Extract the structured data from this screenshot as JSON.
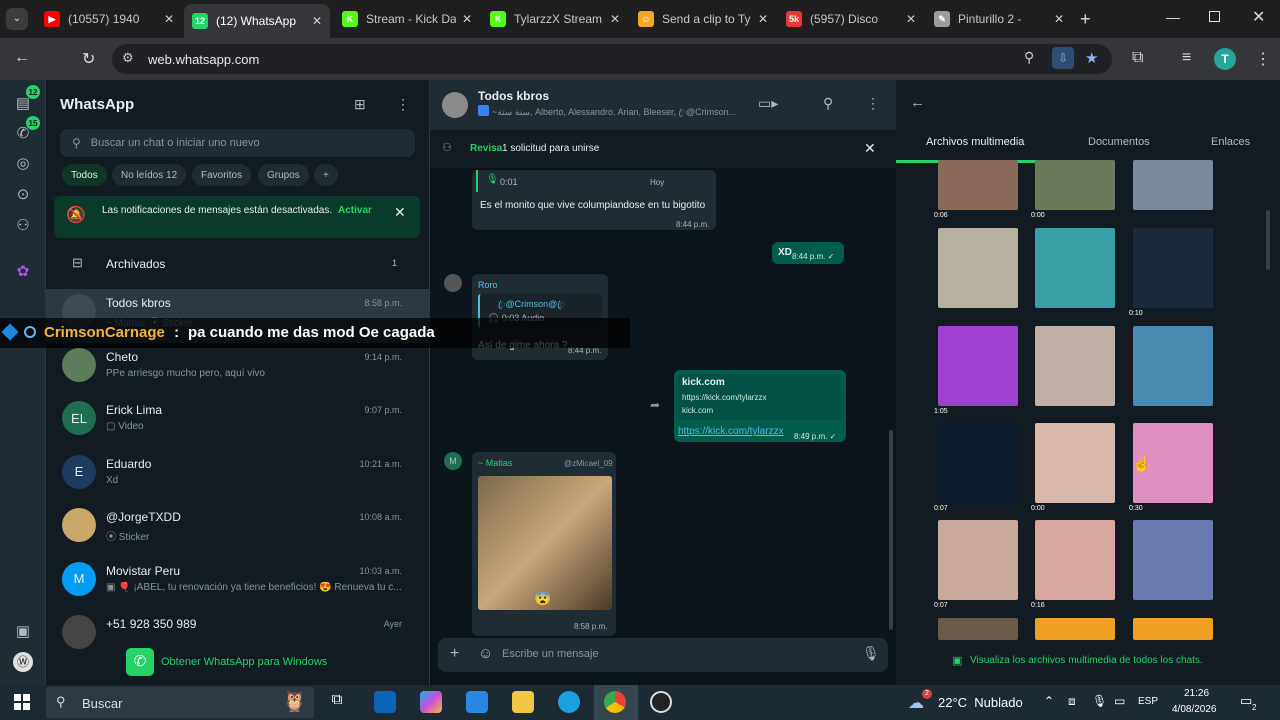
{
  "browser": {
    "tabs": [
      {
        "title": "(10557) 1940",
        "color": "#ff0000",
        "icon": "youtube-icon",
        "glyph": "▶"
      },
      {
        "title": "(12) WhatsApp",
        "color": "#25d366",
        "icon": "whatsapp-icon",
        "glyph": "12"
      },
      {
        "title": "Stream - Kick Da",
        "color": "#53fc18",
        "icon": "kick-icon",
        "glyph": "K"
      },
      {
        "title": "TylarzzX Stream",
        "color": "#53fc18",
        "icon": "kick-icon",
        "glyph": "K"
      },
      {
        "title": "Send a clip to Ty",
        "color": "#f5a623",
        "icon": "clip-icon",
        "glyph": "☺"
      },
      {
        "title": "(5957) Disco",
        "color": "#e53935",
        "icon": "discord-icon",
        "glyph": "5k"
      },
      {
        "title": "Pinturillo 2 -",
        "color": "#9e9e9e",
        "icon": "brush-icon",
        "glyph": "✎"
      }
    ],
    "url": "web.whatsapp.com",
    "profile": "T"
  },
  "rail": {
    "badge_chats": "12",
    "badge_calls": "15"
  },
  "sidebar": {
    "title": "WhatsApp",
    "search_placeholder": "Buscar un chat o iniciar uno nuevo",
    "chips": [
      "Todos",
      "No leídos 12",
      "Favoritos",
      "Grupos",
      "+"
    ],
    "notice": "Las notificaciones de mensajes están desactivadas.",
    "notice_action": "Activar",
    "archived_label": "Archivados",
    "archived_count": "1",
    "chats": [
      {
        "name": "Todos kbros",
        "time": "8:58 p.m.",
        "preview": "~ Matias: ⦿ Sticker",
        "initials": "",
        "color": "#3b4a54"
      },
      {
        "name": "Cheto",
        "time": "9:14 p.m.",
        "preview": "PPe arriesgo mucho pero, aquí vivo",
        "initials": "",
        "color": "#5a7d5a"
      },
      {
        "name": "Erick Lima",
        "time": "9:07 p.m.",
        "preview": "▢ Video",
        "initials": "EL",
        "color": "#1f6e52"
      },
      {
        "name": "Eduardo",
        "time": "10:21 a.m.",
        "preview": "Xd",
        "initials": "E",
        "color": "#1e3a5f"
      },
      {
        "name": "@JorgeTXDD",
        "time": "10:08 a.m.",
        "preview": "⦿ Sticker",
        "initials": "",
        "color": "#c9a86a"
      },
      {
        "name": "Movistar Peru",
        "time": "10:03 a.m.",
        "preview": "▣ 🎈 ¡ABEL, tu renovación ya tiene beneficios! 😍 Renueva tu c...",
        "initials": "M",
        "color": "#019df4"
      },
      {
        "name": "+51 928 350 989",
        "time": "Ayer",
        "preview": "",
        "initials": "",
        "color": "#444"
      }
    ],
    "get_app": "Obtener WhatsApp para Windows"
  },
  "overlay": {
    "user": "CrimsonCarnage",
    "sep": " : ",
    "text": "pa cuando me das mod Oe cagada"
  },
  "chat": {
    "title": "Todos kbros",
    "members": "~سنة ستة, Alberto, Alessandro, Arian, Bleeser, ꦿ@Crimson...",
    "join_request_bold": "Revisa",
    "join_request": "1 solicitud para unirse",
    "audio_time": "0:01",
    "audio_day": "Hoy",
    "msg1": "Es el monito que vive columpiandose en tu bigotito",
    "msg1_time": "8:44 p.m.",
    "msg2": "XD",
    "msg2_time": "8:44 p.m. ✓",
    "msg3_sender": "Roro",
    "msg3_quote_name": "ꦿ@Crimson@ꦿ",
    "msg3_quote": "🎧 0:03 Audio",
    "msg3": "Así de gime ahora ?",
    "msg3_time": "8:44 p.m.",
    "link_title": "kick.com",
    "link_url_preview": "https://kick.com/tylarzzx",
    "link_domain": "kick.com",
    "link_url": "https://kick.com/tylarzzx",
    "link_time": "8:49 p.m. ✓",
    "msg5_sender": "~ Matias",
    "msg5_handle": "@zMicael_09",
    "msg5_time": "8:58 p.m.",
    "compose_placeholder": "Escribe un mensaje"
  },
  "media": {
    "tabs": [
      "Archivos multimedia",
      "Documentos",
      "Enlaces"
    ],
    "durations": [
      "0:06",
      "0:00",
      "",
      "",
      "",
      "0:10",
      "1:05",
      "",
      "",
      "0:07",
      "0:00",
      "0:30",
      "0:07",
      "0:16"
    ],
    "footer": "Visualiza los archivos multimedia de todos los chats."
  },
  "taskbar": {
    "search": "Buscar",
    "weather": "22°C  Nublado",
    "weather_badge": "2",
    "lang": "ESP",
    "time": "21:26",
    "date": "4/08/2026",
    "notif": "2"
  }
}
